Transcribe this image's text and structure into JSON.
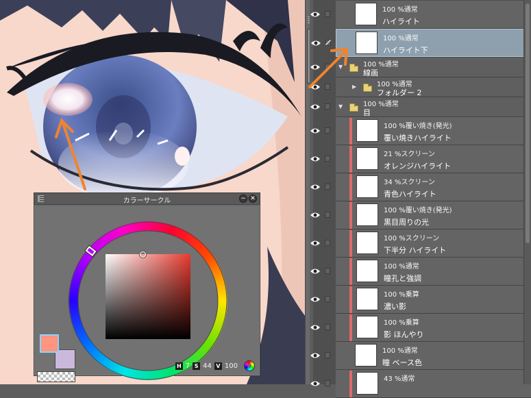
{
  "color_circle": {
    "title": "カラーサークル",
    "minimize_icon": "minimize-icon",
    "close_icon": "close-icon",
    "main_color": "#ff9480",
    "sub_color": "#cbb9dd",
    "hsv": {
      "h_label": "H",
      "h": "7",
      "s_label": "S",
      "s": "44",
      "v_label": "V",
      "v": "100"
    }
  },
  "layers": [
    {
      "mode": "100 %通常",
      "name": "ハイライト",
      "clip": false,
      "selected": false
    },
    {
      "mode": "100 %通常",
      "name": "ハイライト下",
      "clip": false,
      "selected": true
    },
    {
      "folder": true,
      "mode": "100 %通常",
      "name": "線画",
      "open": true
    },
    {
      "folder": true,
      "mode": "100 %通常",
      "name": "フォルダー 2",
      "open": false,
      "indent": true
    },
    {
      "folder": true,
      "mode": "100 %通常",
      "name": "目",
      "open": true
    },
    {
      "mode": "100 %覆い焼き(発光)",
      "name": "覆い焼きハイライト",
      "clip": true
    },
    {
      "mode": "21 %スクリーン",
      "name": "オレンジハイライト",
      "clip": true
    },
    {
      "mode": "34 %スクリーン",
      "name": "青色ハイライト",
      "clip": true
    },
    {
      "mode": "100 %覆い焼き(発光)",
      "name": "黒目周りの光",
      "clip": true
    },
    {
      "mode": "100 %スクリーン",
      "name": "下半分 ハイライト",
      "clip": true
    },
    {
      "mode": "100 %通常",
      "name": "瞳孔と強調",
      "clip": true
    },
    {
      "mode": "100 %乗算",
      "name": "濃い影",
      "clip": true
    },
    {
      "mode": "100 %乗算",
      "name": "影 ほんやり",
      "clip": true
    },
    {
      "mode": "100 %通常",
      "name": "瞳 ベース色",
      "clip": false
    },
    {
      "mode": "43 %通常",
      "name": "",
      "clip": true
    }
  ],
  "icons": {
    "visibility": "eye-icon",
    "edit": "pen-icon",
    "lock": "lock-icon",
    "folder": "folder-icon"
  },
  "accent": "#f0842e"
}
